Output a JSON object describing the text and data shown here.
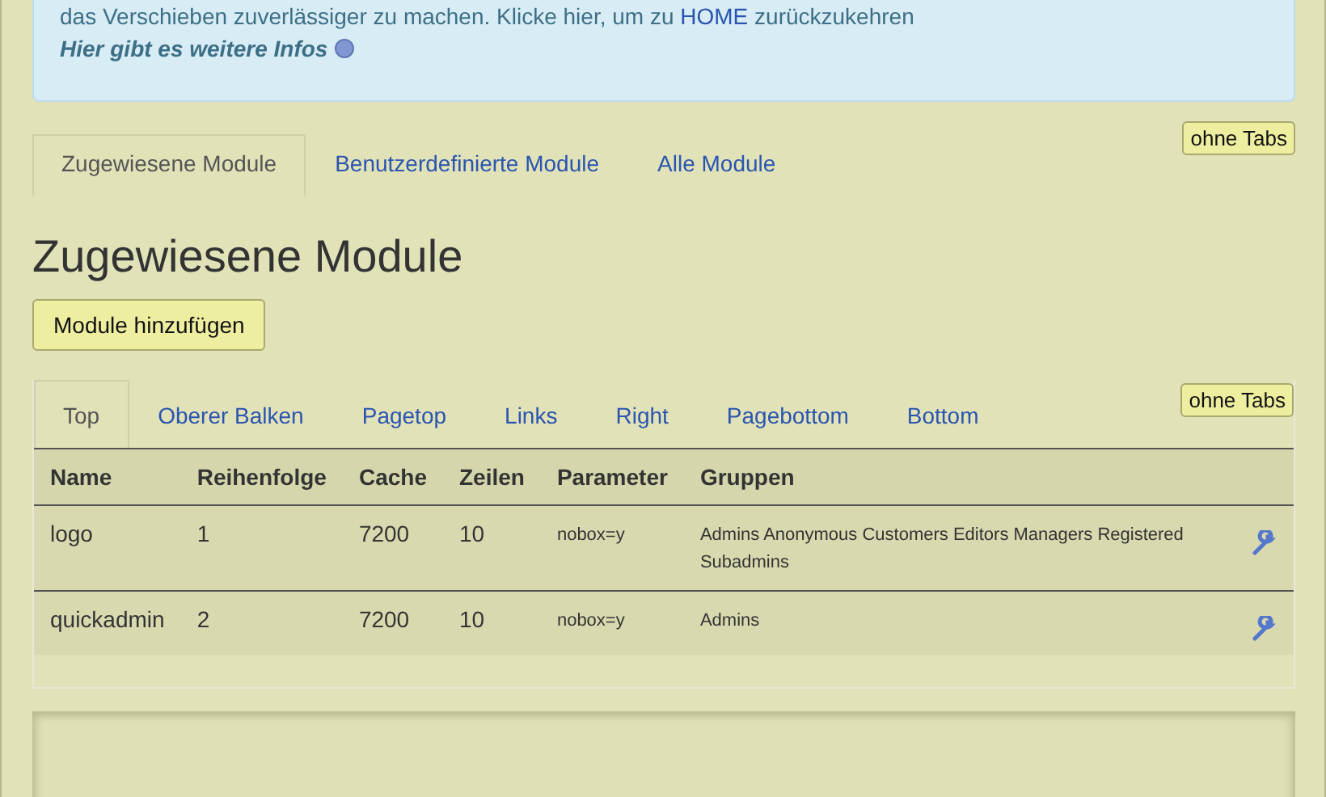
{
  "info": {
    "line": "das Verschieben zuverlässiger zu machen. Klicke hier, um zu ",
    "link": "HOME",
    "after": " zurückzukehren",
    "more": "Hier gibt es weitere Infos"
  },
  "tabs": [
    {
      "label": "Zugewiesene Module",
      "selected": true
    },
    {
      "label": "Benutzerdefinierte Module",
      "selected": false
    },
    {
      "label": "Alle Module",
      "selected": false
    }
  ],
  "tabs_toggle": "ohne Tabs",
  "heading": "Zugewiesene Module",
  "add_button": "Module hinzufügen",
  "position_tabs": [
    {
      "label": "Top",
      "selected": true
    },
    {
      "label": "Oberer Balken",
      "selected": false
    },
    {
      "label": "Pagetop",
      "selected": false
    },
    {
      "label": "Links",
      "selected": false
    },
    {
      "label": "Right",
      "selected": false
    },
    {
      "label": "Pagebottom",
      "selected": false
    },
    {
      "label": "Bottom",
      "selected": false
    }
  ],
  "position_tabs_toggle": "ohne Tabs",
  "table": {
    "columns": [
      "Name",
      "Reihenfolge",
      "Cache",
      "Zeilen",
      "Parameter",
      "Gruppen"
    ],
    "rows": [
      [
        "logo",
        "1",
        "7200",
        "10",
        "nobox=y",
        "Admins Anonymous Customers Editors Managers Registered Subadmins"
      ],
      [
        "quickadmin",
        "2",
        "7200",
        "10",
        "nobox=y",
        "Admins"
      ]
    ]
  }
}
